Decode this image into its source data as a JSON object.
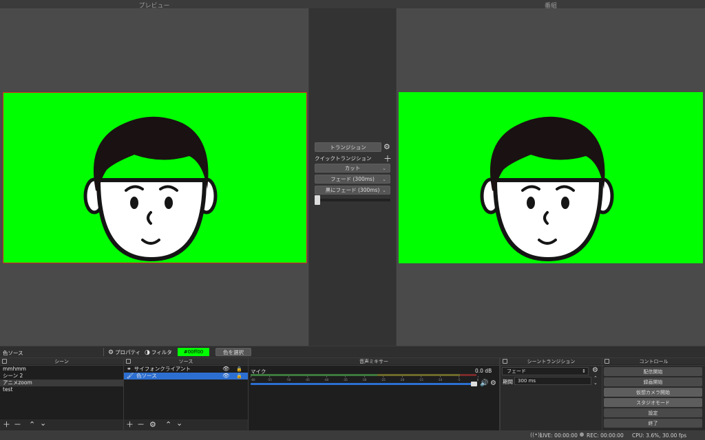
{
  "preview": {
    "title": "プレビュー"
  },
  "program": {
    "title": "番組"
  },
  "transitions_center": {
    "transition_button": "トランジション",
    "quick_transition_label": "クイックトランジション",
    "items": [
      "カット",
      "フェード (300ms)",
      "黒にフェード (300ms)"
    ]
  },
  "source_toolbar": {
    "selected_source": "色ソース",
    "properties_label": "プロパティ",
    "filters_label": "フィルタ",
    "color_value": "#00ff00",
    "color_swatch": "#00ff00",
    "select_color_label": "色を選択"
  },
  "scenes": {
    "title": "シーン",
    "items": [
      "mmhmm",
      "シーン 2",
      "アニメzoom",
      "test"
    ],
    "selected_index": 2
  },
  "sources": {
    "title": "ソース",
    "items": [
      "サイフォンクライアント",
      "色ソース"
    ],
    "selected_index": 1
  },
  "mixer": {
    "title": "音声ミキサー",
    "channel_name": "マイク",
    "db_value": "0.0 dB",
    "scale": [
      "-60",
      "-55",
      "-50",
      "-45",
      "-40",
      "-35",
      "-30",
      "-25",
      "-20",
      "-15",
      "-10",
      "-5",
      "0"
    ],
    "volume_fraction": 0.95
  },
  "scene_transitions": {
    "title": "シーントランジション",
    "transition_select": "フェード",
    "duration_label": "期間",
    "duration_value": "300 ms"
  },
  "controls": {
    "title": "コントロール",
    "buttons": [
      "配信開始",
      "録画開始",
      "仮想カメラ開始",
      "スタジオモード",
      "設定",
      "終了"
    ]
  },
  "status_bar": {
    "live": "LIVE: 00:00:00",
    "rec": "REC: 00:00:00",
    "cpu": "CPU: 3.6%, 30.00 fps"
  },
  "colors": {
    "chroma_green": "#00ff00",
    "selection_blue": "#2d6fd1",
    "meter_green": "#4cae4c",
    "meter_yellow": "#c9a227",
    "meter_red": "#c0392b"
  }
}
